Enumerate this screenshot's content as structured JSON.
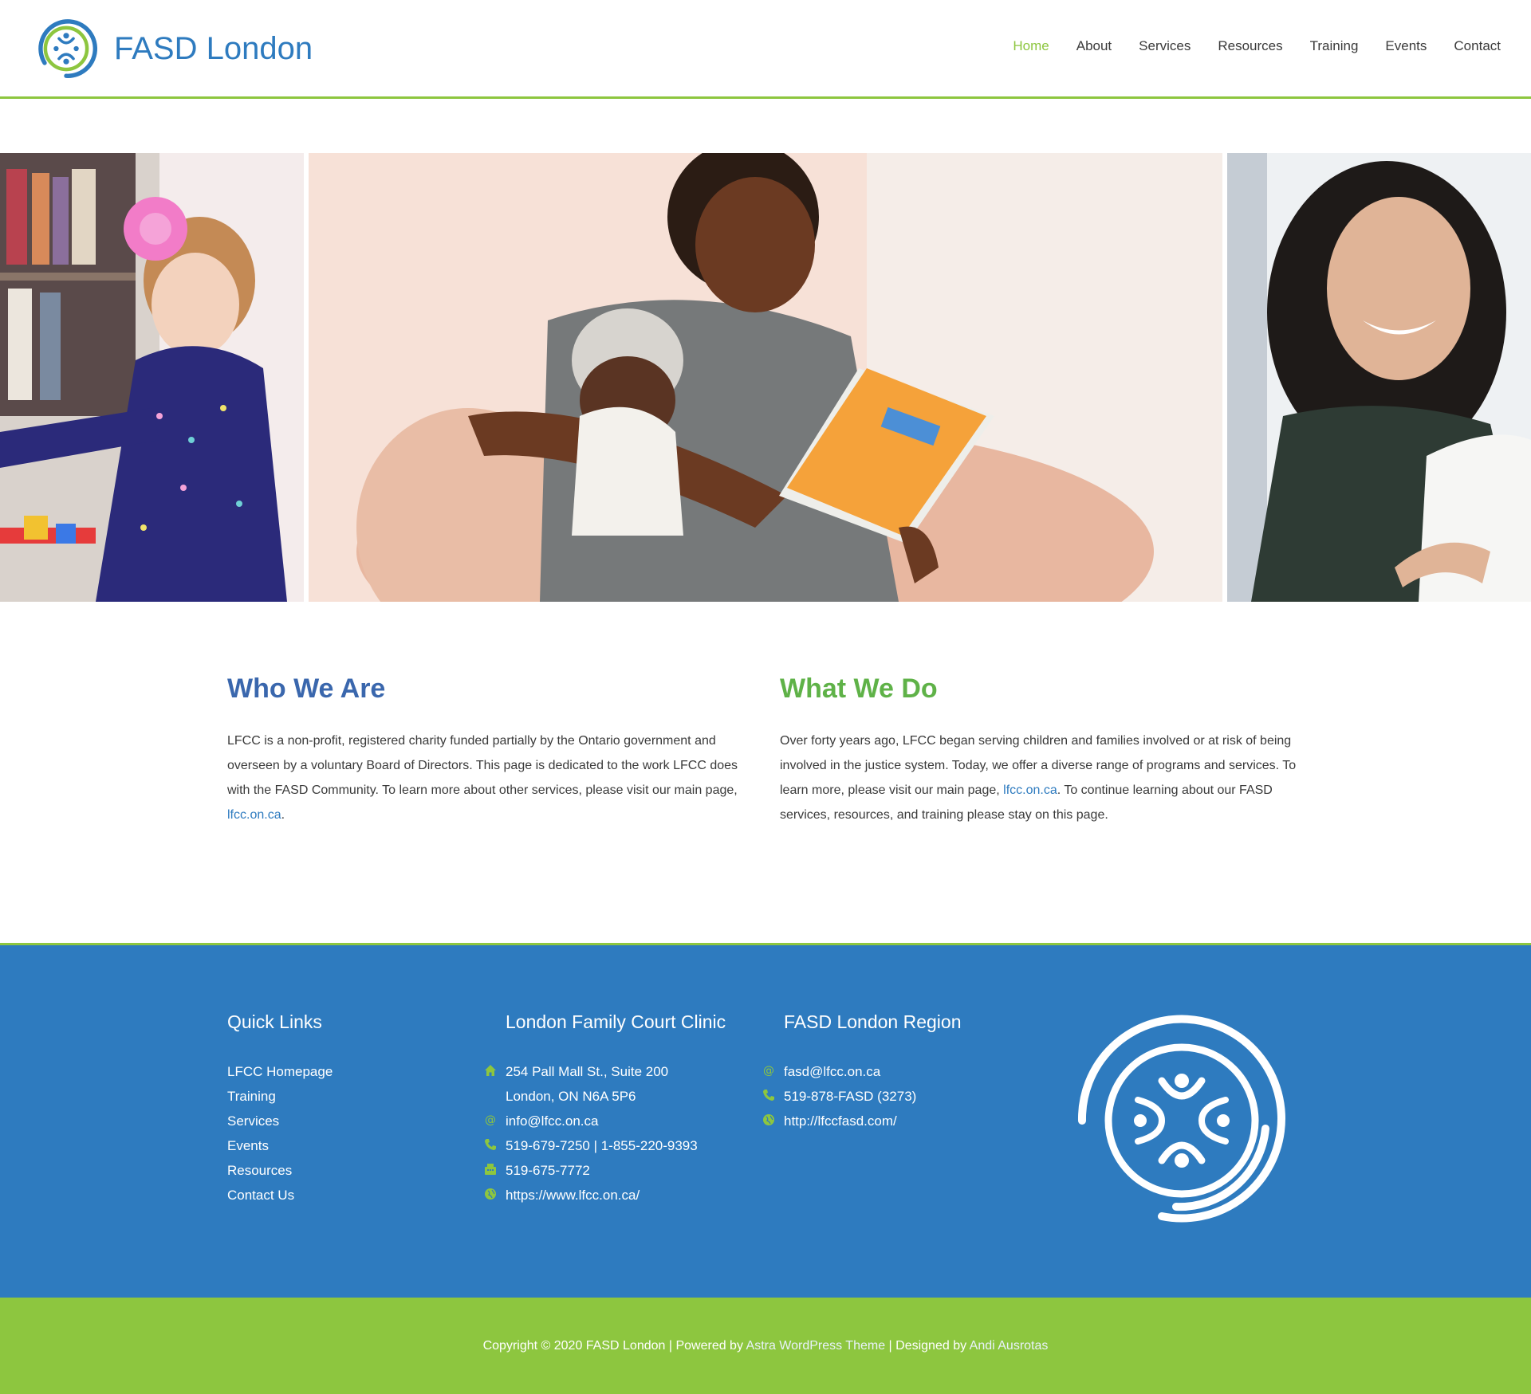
{
  "header": {
    "site_title": "FASD London",
    "nav": [
      {
        "label": "Home",
        "active": true
      },
      {
        "label": "About"
      },
      {
        "label": "Services"
      },
      {
        "label": "Resources"
      },
      {
        "label": "Training"
      },
      {
        "label": "Events"
      },
      {
        "label": "Contact"
      }
    ]
  },
  "slider": {
    "slide_count": 5,
    "active_slide": 2
  },
  "who_we_are": {
    "title": "Who We Are",
    "body": "LFCC is a non-profit, registered charity funded partially by the Ontario government and overseen by a voluntary Board of Directors. This page is dedicated to the work LFCC does with the FASD Community. To learn more about other services, please visit our main page, ",
    "link": "lfcc.on.ca",
    "suffix": "."
  },
  "what_we_do": {
    "title": "What We Do",
    "body": "Over forty years ago, LFCC began serving children and families involved or at risk of being involved in the justice system. Today, we offer a diverse range of programs and services. To learn more, please visit our main page, ",
    "link": "lfcc.on.ca",
    "suffix": ". To continue learning about our FASD services, resources, and training please stay on this page."
  },
  "footer": {
    "quick_links": {
      "title": "Quick Links",
      "items": [
        "LFCC Homepage",
        "Training",
        "Services",
        "Events",
        "Resources",
        "Contact Us"
      ]
    },
    "clinic": {
      "title": "London Family Court Clinic",
      "address_line1": "254 Pall Mall St., Suite 200",
      "address_line2": "London, ON N6A 5P6",
      "email": "info@lfcc.on.ca",
      "phone": "519-679-7250 | 1-855-220-9393",
      "fax": "519-675-7772",
      "website": "https://www.lfcc.on.ca/"
    },
    "region": {
      "title": "FASD London Region",
      "email": "fasd@lfcc.on.ca",
      "phone": "519-878-FASD (3273)",
      "website": "http://lfccfasd.com/"
    },
    "icons": {
      "home": "home-icon",
      "email": "at-icon",
      "phone": "phone-icon",
      "fax": "fax-icon",
      "web": "globe-icon"
    }
  },
  "bottom_bar": {
    "copyright": "Copyright © 2020 FASD London | Powered by ",
    "theme_link": "Astra WordPress Theme",
    "designed_by": " | Designed by ",
    "designer_link": "Andi Ausrotas"
  },
  "colors": {
    "brand_blue": "#2e7bbf",
    "brand_green": "#8dc63f",
    "heading_blue": "#3a67ad",
    "heading_green": "#5fb248"
  }
}
